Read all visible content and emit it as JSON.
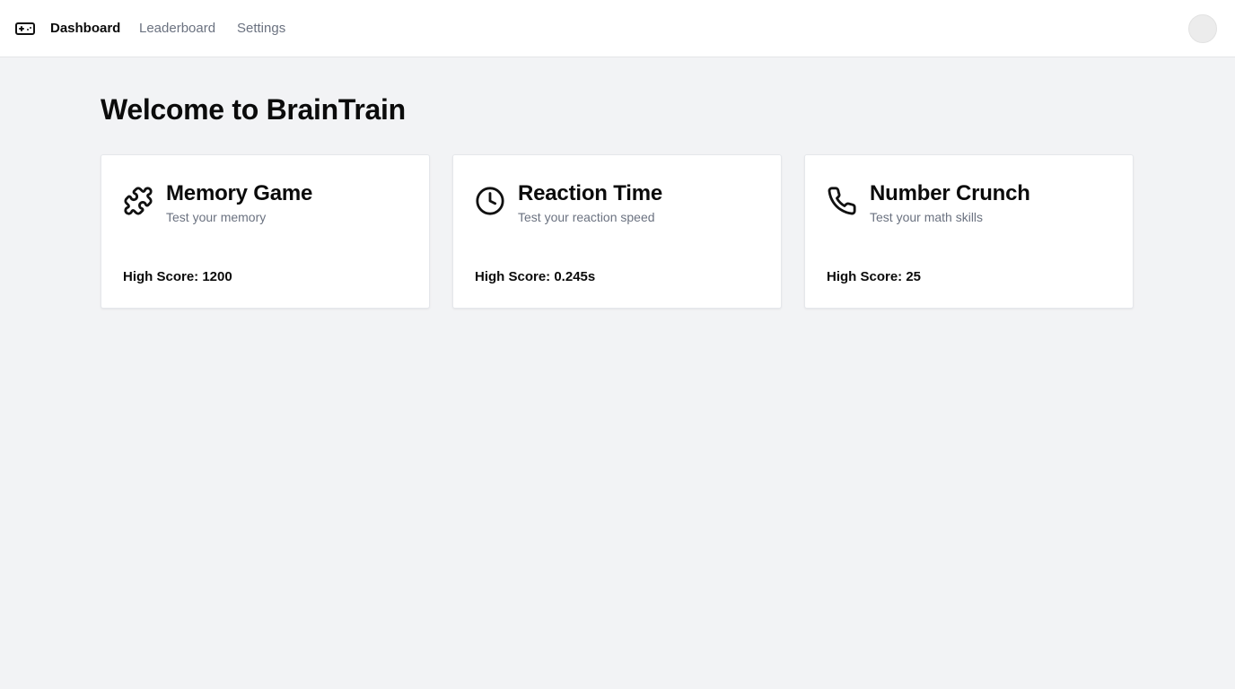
{
  "nav": {
    "logo_icon": "gamepad-icon",
    "items": [
      {
        "label": "Dashboard",
        "active": true
      },
      {
        "label": "Leaderboard",
        "active": false
      },
      {
        "label": "Settings",
        "active": false
      }
    ],
    "avatar_icon": "user-avatar"
  },
  "main": {
    "title": "Welcome to BrainTrain",
    "games": [
      {
        "icon": "puzzle-icon",
        "title": "Memory Game",
        "subtitle": "Test your memory",
        "high_score": "High Score: 1200"
      },
      {
        "icon": "clock-icon",
        "title": "Reaction Time",
        "subtitle": "Test your reaction speed",
        "high_score": "High Score: 0.245s"
      },
      {
        "icon": "phone-icon",
        "title": "Number Crunch",
        "subtitle": "Test your math skills",
        "high_score": "High Score: 25"
      }
    ]
  },
  "colors": {
    "background": "#f2f3f5",
    "surface": "#ffffff",
    "text": "#0b0b0b",
    "muted": "#6b7280"
  }
}
